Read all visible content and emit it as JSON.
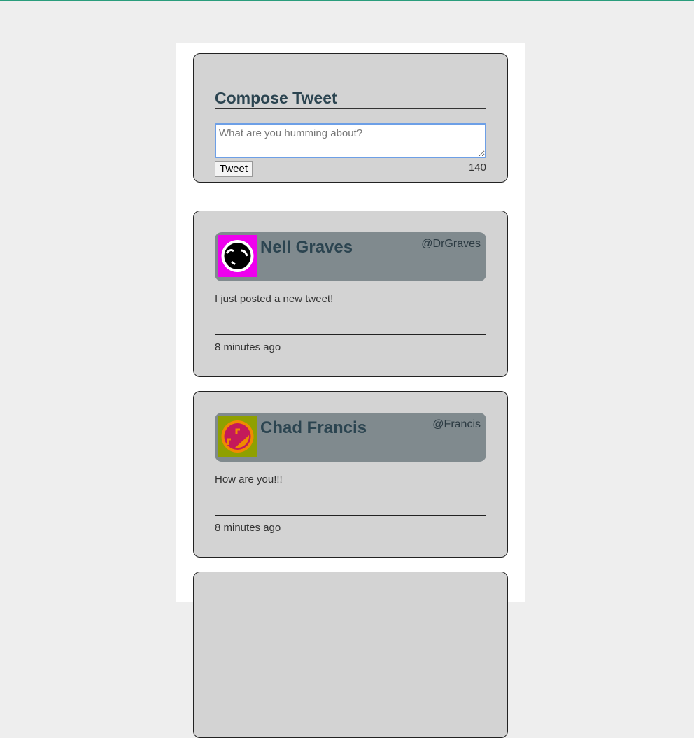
{
  "colors": {
    "accent": "#2a9d7c",
    "header_bg": "#808a8e",
    "card_bg": "#d3d3d3"
  },
  "compose": {
    "title": "Compose Tweet",
    "placeholder": "What are you humming about?",
    "button": "Tweet",
    "counter": "140"
  },
  "tweets": [
    {
      "name": "Nell Graves",
      "handle": "@DrGraves",
      "text": "I just posted a new tweet!",
      "time": "8 minutes ago",
      "avatar": "magenta-face-avatar"
    },
    {
      "name": "Chad Francis",
      "handle": "@Francis",
      "text": "How are you!!!",
      "time": "8 minutes ago",
      "avatar": "olive-face-avatar"
    }
  ]
}
